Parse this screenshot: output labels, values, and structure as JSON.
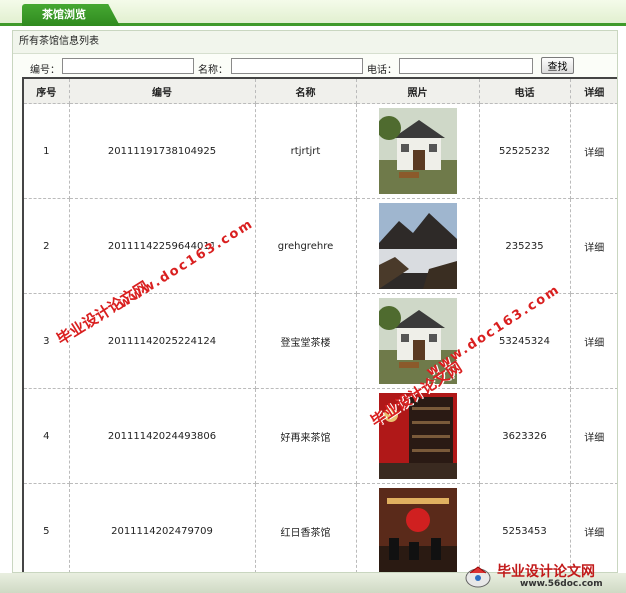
{
  "tab": {
    "label": "茶馆浏览"
  },
  "panel": {
    "title": "所有茶馆信息列表"
  },
  "search": {
    "id_label": "编号：",
    "name_label": "名称：",
    "phone_label": "电话：",
    "id_value": "",
    "name_value": "",
    "phone_value": "",
    "button_label": "查找"
  },
  "table": {
    "headers": [
      "序号",
      "编号",
      "名称",
      "照片",
      "电话",
      "详细"
    ],
    "rows": [
      {
        "index": "1",
        "code": "20111191738104925",
        "name": "rtjrtjrt",
        "phone": "52525232",
        "detail": "详细",
        "photo": "house"
      },
      {
        "index": "2",
        "code": "20111142259644011",
        "name": "grehgrehre",
        "phone": "235235",
        "detail": "详细",
        "photo": "mountain"
      },
      {
        "index": "3",
        "code": "20111142025224124",
        "name": "登宝堂茶楼",
        "phone": "53245324",
        "detail": "详细",
        "photo": "house"
      },
      {
        "index": "4",
        "code": "20111142024493806",
        "name": "好再来茶馆",
        "phone": "3623326",
        "detail": "详细",
        "photo": "shelf"
      },
      {
        "index": "5",
        "code": "2011114202479709",
        "name": "红日香茶馆",
        "phone": "5253453",
        "detail": "详细",
        "photo": "hall"
      }
    ]
  },
  "watermark": {
    "site_name": "毕业设计论文网",
    "url": "www.doc163.com",
    "logo_title": "毕业设计论文网",
    "logo_url": "www.56doc.com"
  },
  "colors": {
    "brand_green": "#3f9a2a",
    "watermark_red": "#d91f1f"
  }
}
